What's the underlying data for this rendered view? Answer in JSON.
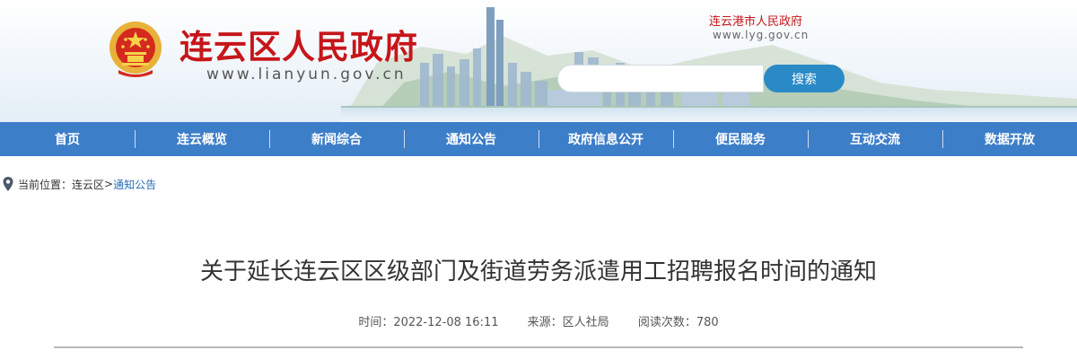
{
  "header": {
    "site_title": "连云区人民政府",
    "site_url": "www.lianyun.gov.cn",
    "parent_name": "连云港市人民政府",
    "parent_url": "www.lyg.gov.cn",
    "search_placeholder": "",
    "search_button": "搜索"
  },
  "nav": {
    "items": [
      {
        "label": "首页"
      },
      {
        "label": "连云概览"
      },
      {
        "label": "新闻综合"
      },
      {
        "label": "通知公告"
      },
      {
        "label": "政府信息公开"
      },
      {
        "label": "便民服务"
      },
      {
        "label": "互动交流"
      },
      {
        "label": "数据开放"
      }
    ]
  },
  "breadcrumb": {
    "prefix": "当前位置：",
    "home": "连云区",
    "separator": ">",
    "current": "通知公告"
  },
  "article": {
    "title": "关于延长连云区区级部门及街道劳务派遣用工招聘报名时间的通知",
    "time_label": "时间：",
    "time_value": "2022-12-08 16:11",
    "source_label": "来源：",
    "source_value": "区人社局",
    "views_label": "阅读次数：",
    "views_value": "780"
  },
  "colors": {
    "brand_red": "#c6161a",
    "nav_blue": "#3d7ec8",
    "search_blue": "#2a8ac6",
    "link_blue": "#2a6db3"
  },
  "icons": {
    "emblem": "national-emblem-icon",
    "location": "location-pin-icon"
  }
}
